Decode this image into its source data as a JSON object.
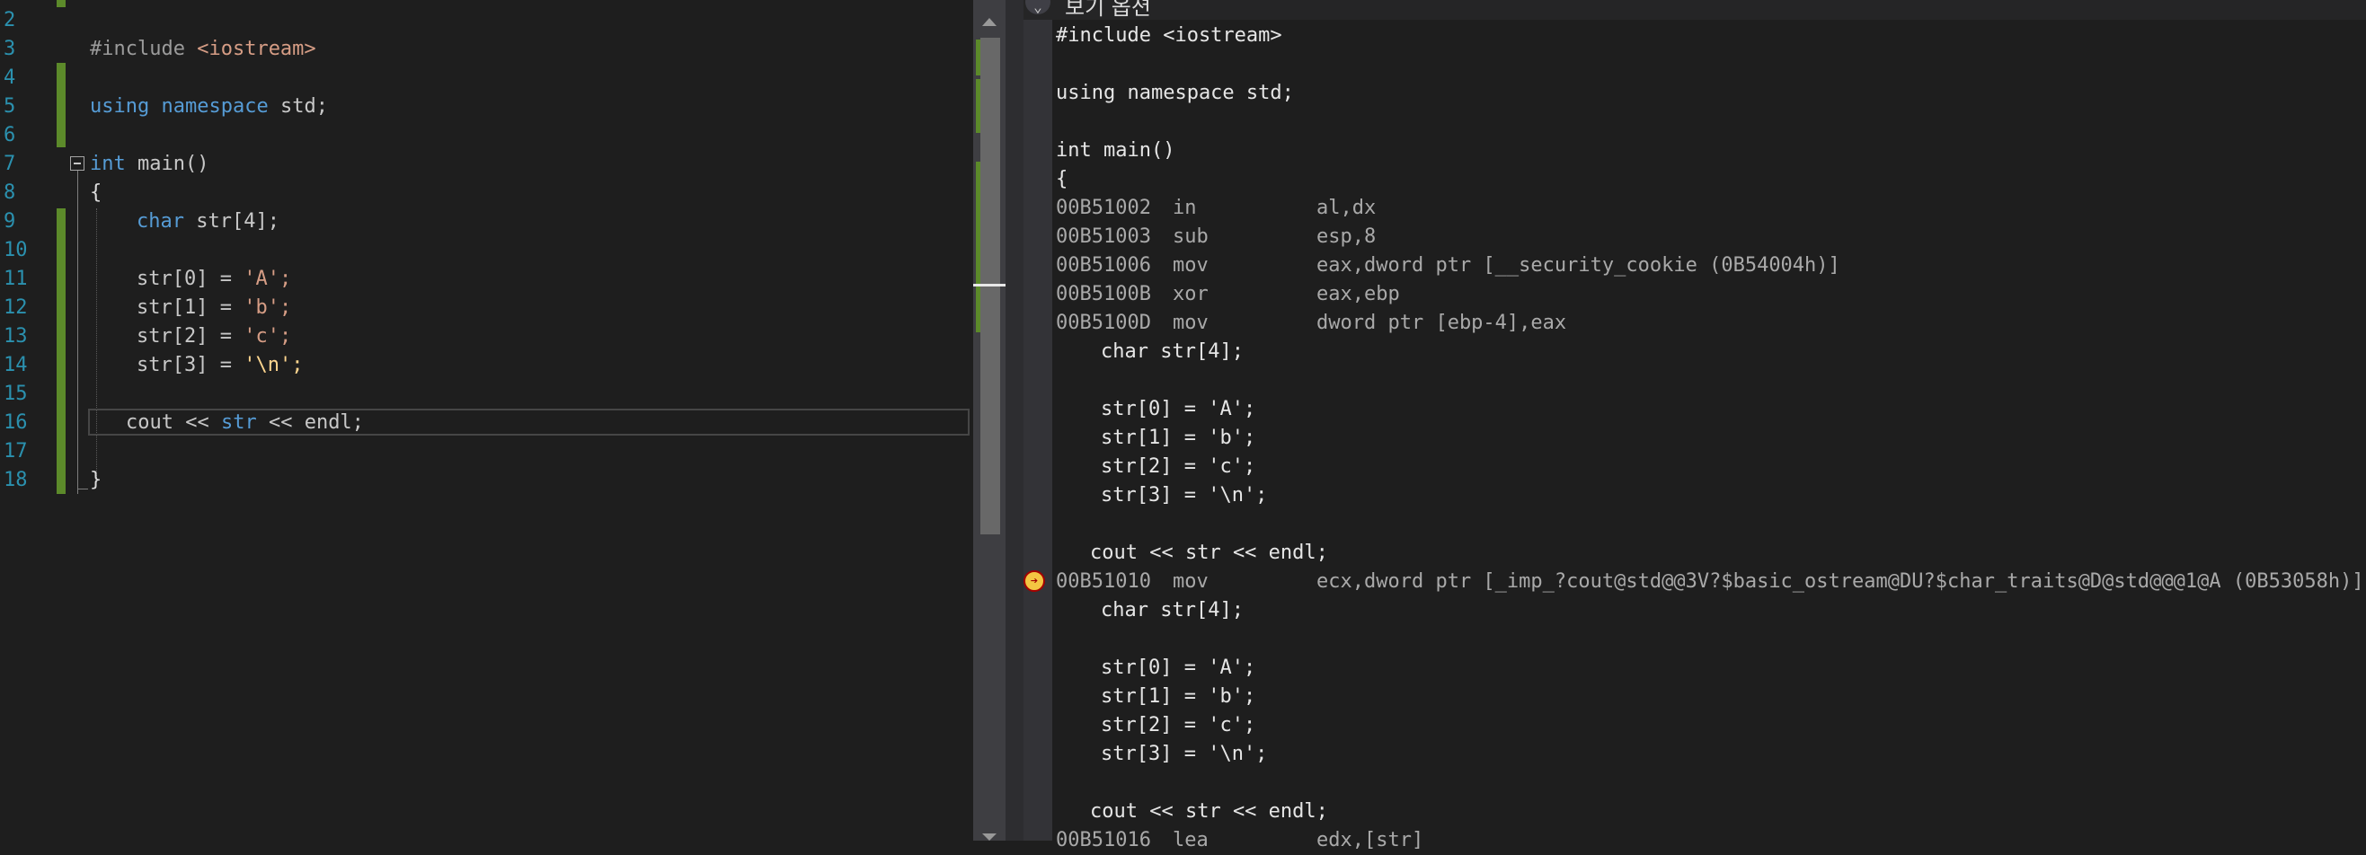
{
  "editor": {
    "line_numbers": [
      "2",
      "3",
      "4",
      "5",
      "6",
      "7",
      "8",
      "9",
      "10",
      "11",
      "12",
      "13",
      "14",
      "15",
      "16",
      "17",
      "18"
    ],
    "code": {
      "include_directive": "#include",
      "include_file": "<iostream>",
      "using_kw": "using",
      "namespace_kw": "namespace",
      "std_ident": "std;",
      "int_kw": "int",
      "main_sig": "main()",
      "open_brace": "{",
      "char_kw": "char",
      "char_decl": "str[4];",
      "assign_0": "str[0] = ",
      "assign_1": "str[1] = ",
      "assign_2": "str[2] = ",
      "assign_3": "str[3] = ",
      "val_0": "'A';",
      "val_1": "'b';",
      "val_2": "'c';",
      "val_3": "'\\n';",
      "cout_line_a": "cout << ",
      "cout_line_b": "str",
      "cout_line_c": " << endl;",
      "close_brace": "}"
    }
  },
  "disassembly": {
    "header_label": "보기 옵션",
    "chevron": "⌄",
    "lines": [
      {
        "kind": "src",
        "indent": 0,
        "text": "#include <iostream>"
      },
      {
        "kind": "blank"
      },
      {
        "kind": "src",
        "indent": 0,
        "text": "using namespace std;"
      },
      {
        "kind": "blank"
      },
      {
        "kind": "src",
        "indent": 0,
        "text": "int main()"
      },
      {
        "kind": "src",
        "indent": 0,
        "text": "{"
      },
      {
        "kind": "asm",
        "addr": "00B51002",
        "mnemonic": "in",
        "operands": "al,dx"
      },
      {
        "kind": "asm",
        "addr": "00B51003",
        "mnemonic": "sub",
        "operands": "esp,8"
      },
      {
        "kind": "asm",
        "addr": "00B51006",
        "mnemonic": "mov",
        "operands": "eax,dword ptr [__security_cookie (0B54004h)]"
      },
      {
        "kind": "asm",
        "addr": "00B5100B",
        "mnemonic": "xor",
        "operands": "eax,ebp"
      },
      {
        "kind": "asm",
        "addr": "00B5100D",
        "mnemonic": "mov",
        "operands": "dword ptr [ebp-4],eax"
      },
      {
        "kind": "src",
        "indent": 2,
        "text": "char str[4];"
      },
      {
        "kind": "blank"
      },
      {
        "kind": "src",
        "indent": 2,
        "text": "str[0] = 'A';"
      },
      {
        "kind": "src",
        "indent": 2,
        "text": "str[1] = 'b';"
      },
      {
        "kind": "src",
        "indent": 2,
        "text": "str[2] = 'c';"
      },
      {
        "kind": "src",
        "indent": 2,
        "text": "str[3] = '\\n';"
      },
      {
        "kind": "blank"
      },
      {
        "kind": "src",
        "indent": 1,
        "text": "cout << str << endl;"
      },
      {
        "kind": "asm",
        "addr": "00B51010",
        "mnemonic": "mov",
        "operands": "ecx,dword ptr [_imp_?cout@std@@3V?$basic_ostream@DU?$char_traits@D@std@@@1@A (0B53058h)]",
        "current": true
      },
      {
        "kind": "src",
        "indent": 2,
        "text": "char str[4];"
      },
      {
        "kind": "blank"
      },
      {
        "kind": "src",
        "indent": 2,
        "text": "str[0] = 'A';"
      },
      {
        "kind": "src",
        "indent": 2,
        "text": "str[1] = 'b';"
      },
      {
        "kind": "src",
        "indent": 2,
        "text": "str[2] = 'c';"
      },
      {
        "kind": "src",
        "indent": 2,
        "text": "str[3] = '\\n';"
      },
      {
        "kind": "blank"
      },
      {
        "kind": "src",
        "indent": 1,
        "text": "cout << str << endl;"
      },
      {
        "kind": "asm",
        "addr": "00B51016",
        "mnemonic": "lea",
        "operands": "edx,[str]"
      }
    ]
  },
  "colors": {
    "keyword": "#569cd6",
    "string": "#d69d85",
    "change_bar": "#5c8a2a",
    "background": "#1e1e1e"
  }
}
